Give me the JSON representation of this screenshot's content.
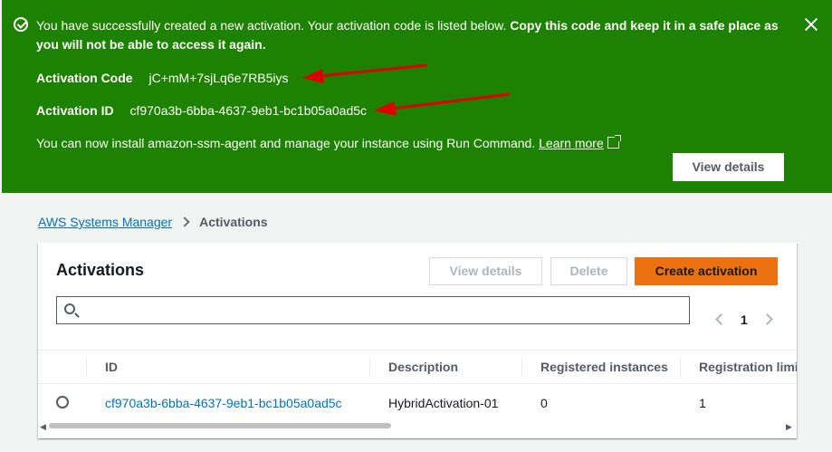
{
  "flash": {
    "message_normal": "You have successfully created a new activation. Your activation code is listed below. ",
    "message_bold": "Copy this code and keep it in a safe place as you will not be able to access it again.",
    "activation_code_label": "Activation Code",
    "activation_code_value": "jC+mM+7sjLq6e7RB5iys",
    "activation_id_label": "Activation ID",
    "activation_id_value": "cf970a3b-6bba-4637-9eb1-bc1b05a0ad5c",
    "install_text": "You can now install amazon-ssm-agent and manage your instance using Run Command. ",
    "learn_more": "Learn more",
    "view_details": "View details",
    "color": "#1d8102"
  },
  "breadcrumb": {
    "root": "AWS Systems Manager",
    "current": "Activations"
  },
  "panel": {
    "title": "Activations",
    "view_details": "View details",
    "delete": "Delete",
    "create": "Create activation",
    "create_color": "#ec7211",
    "search_placeholder": "",
    "page": "1",
    "columns": [
      "ID",
      "Description",
      "Registered instances",
      "Registration limit"
    ],
    "rows": [
      {
        "id": "cf970a3b-6bba-4637-9eb1-bc1b05a0ad5c",
        "description": "HybridActivation-01",
        "registered": "0",
        "limit": "1"
      }
    ]
  },
  "icons": {
    "success": "check-circle-icon",
    "close": "close-icon",
    "external": "external-link-icon",
    "search": "search-icon",
    "prev": "chevron-left-icon",
    "next": "chevron-right-icon"
  }
}
